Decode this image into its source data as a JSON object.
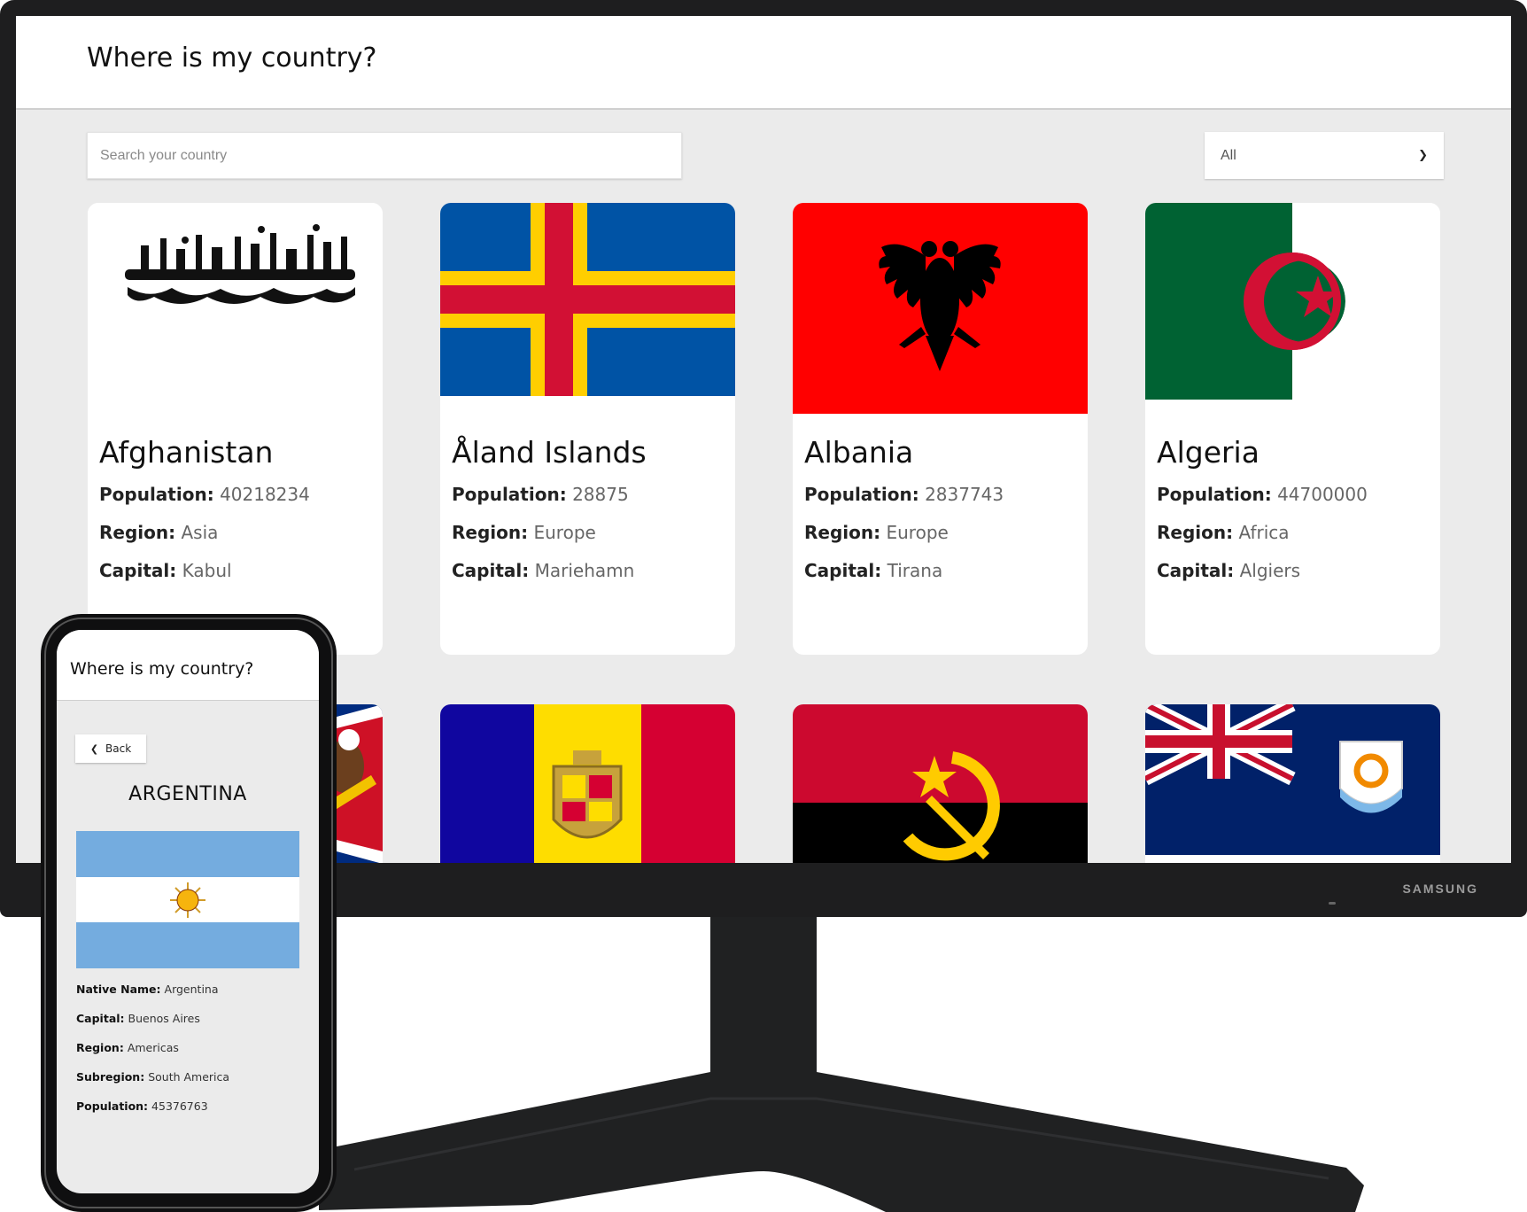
{
  "app": {
    "title": "Where is my country?"
  },
  "search": {
    "placeholder": "Search your country"
  },
  "region_filter": {
    "selected": "All",
    "caret": "⌄"
  },
  "labels": {
    "population": "Population:",
    "region": "Region:",
    "capital": "Capital:",
    "native_name": "Native Name:",
    "subregion": "Subregion:"
  },
  "countries": [
    {
      "name": "Afghanistan",
      "population": "40218234",
      "region": "Asia",
      "capital": "Kabul"
    },
    {
      "name": "Åland Islands",
      "population": "28875",
      "region": "Europe",
      "capital": "Mariehamn"
    },
    {
      "name": "Albania",
      "population": "2837743",
      "region": "Europe",
      "capital": "Tirana"
    },
    {
      "name": "Algeria",
      "population": "44700000",
      "region": "Africa",
      "capital": "Algiers"
    }
  ],
  "second_row_flags": [
    "american-samoa-flag",
    "andorra-flag",
    "angola-flag",
    "anguilla-flag"
  ],
  "monitor": {
    "brand": "SAMSUNG"
  },
  "phone": {
    "title": "Where is my country?",
    "back_label": "Back",
    "country": "ARGENTINA",
    "native_name": "Argentina",
    "capital": "Buenos Aires",
    "region": "Americas",
    "subregion": "South America",
    "population": "45376763"
  },
  "colors": {
    "background": "#ebebeb",
    "card": "#ffffff",
    "monitor_frame": "#1e1e1f"
  }
}
